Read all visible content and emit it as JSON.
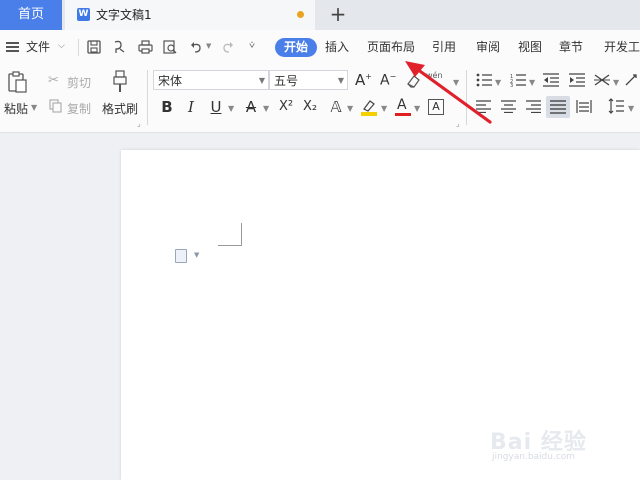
{
  "tabs": {
    "home": "首页",
    "doc_title": "文字文稿1",
    "doc_icon_letter": "W",
    "add": "+"
  },
  "menu": {
    "file": "文件",
    "items": [
      "开始",
      "插入",
      "页面布局",
      "引用",
      "审阅",
      "视图",
      "章节",
      "开发工"
    ]
  },
  "ribbon": {
    "paste": "粘贴",
    "cut": "剪切",
    "copy": "复制",
    "format_painter": "格式刷",
    "font_name": "宋体",
    "font_size": "五号",
    "wen": "wén",
    "bold": "B",
    "italic": "I",
    "underline": "U",
    "superscript": "X²",
    "subscript": "X₂",
    "font_color_a": "A"
  },
  "watermark": {
    "text": "Bai 经验",
    "url": "jingyan.baidu.com"
  },
  "colors": {
    "accent": "#4a7ee8",
    "highlight_yellow": "#f5d000",
    "font_red": "#e02020",
    "arrow_red": "#e0202a"
  }
}
